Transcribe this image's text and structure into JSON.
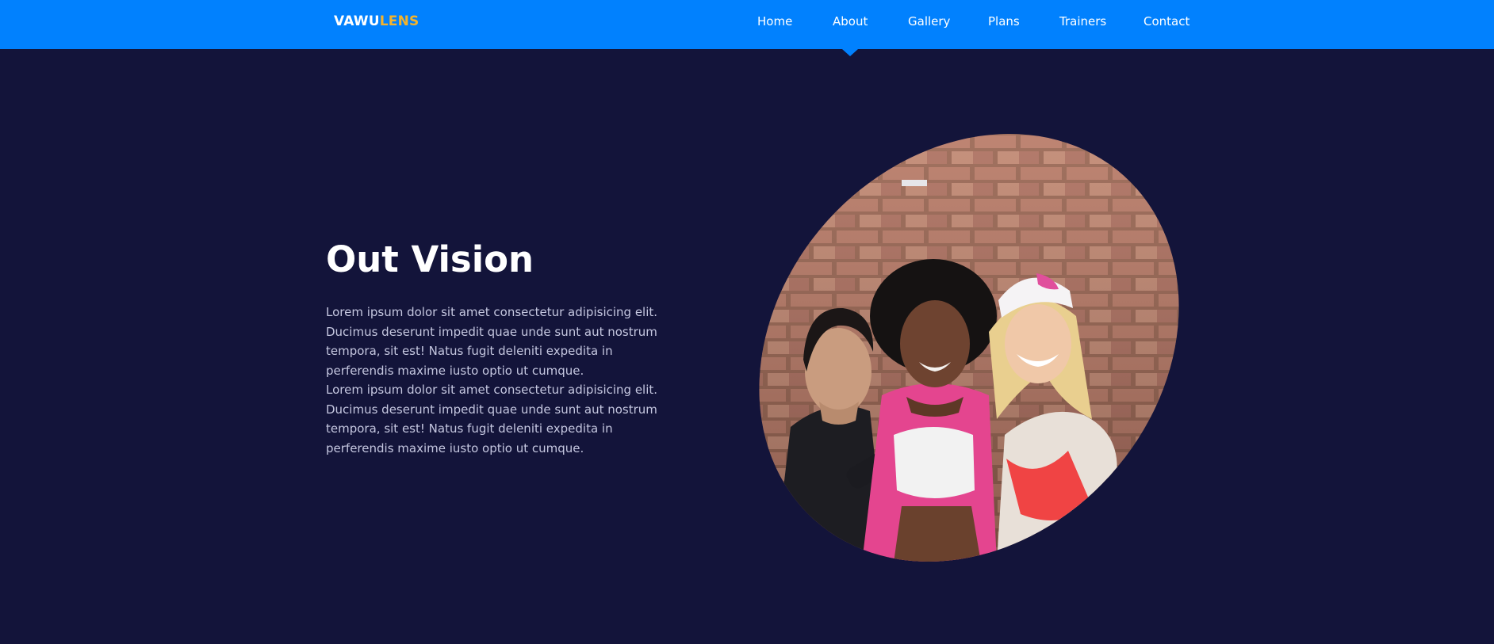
{
  "brand": {
    "logo_part1": "VAWU",
    "logo_part2": "LENS"
  },
  "nav": {
    "items": [
      {
        "label": "Home"
      },
      {
        "label": "About"
      },
      {
        "label": "Gallery"
      },
      {
        "label": "Plans"
      },
      {
        "label": "Trainers"
      },
      {
        "label": "Contact"
      }
    ],
    "active": "About"
  },
  "about": {
    "title": "Out Vision",
    "paragraphs": [
      "Lorem ipsum dolor sit amet consectetur adipisicing elit. Ducimus deserunt impedit quae unde sunt aut nostrum tempora, sit est! Natus fugit deleniti expedita in perferendis maxime iusto optio ut cumque.",
      "Lorem ipsum dolor sit amet consectetur adipisicing elit. Ducimus deserunt impedit quae unde sunt aut nostrum tempora, sit est! Natus fugit deleniti expedita in perferendis maxime iusto optio ut cumque."
    ],
    "image_alt": "Three smiling women in fitness wear in front of a brick wall"
  },
  "colors": {
    "nav_bg": "#0181fe",
    "page_bg": "#13143a",
    "logo_accent": "#f3b32c",
    "body_text": "#c5c7e0"
  }
}
